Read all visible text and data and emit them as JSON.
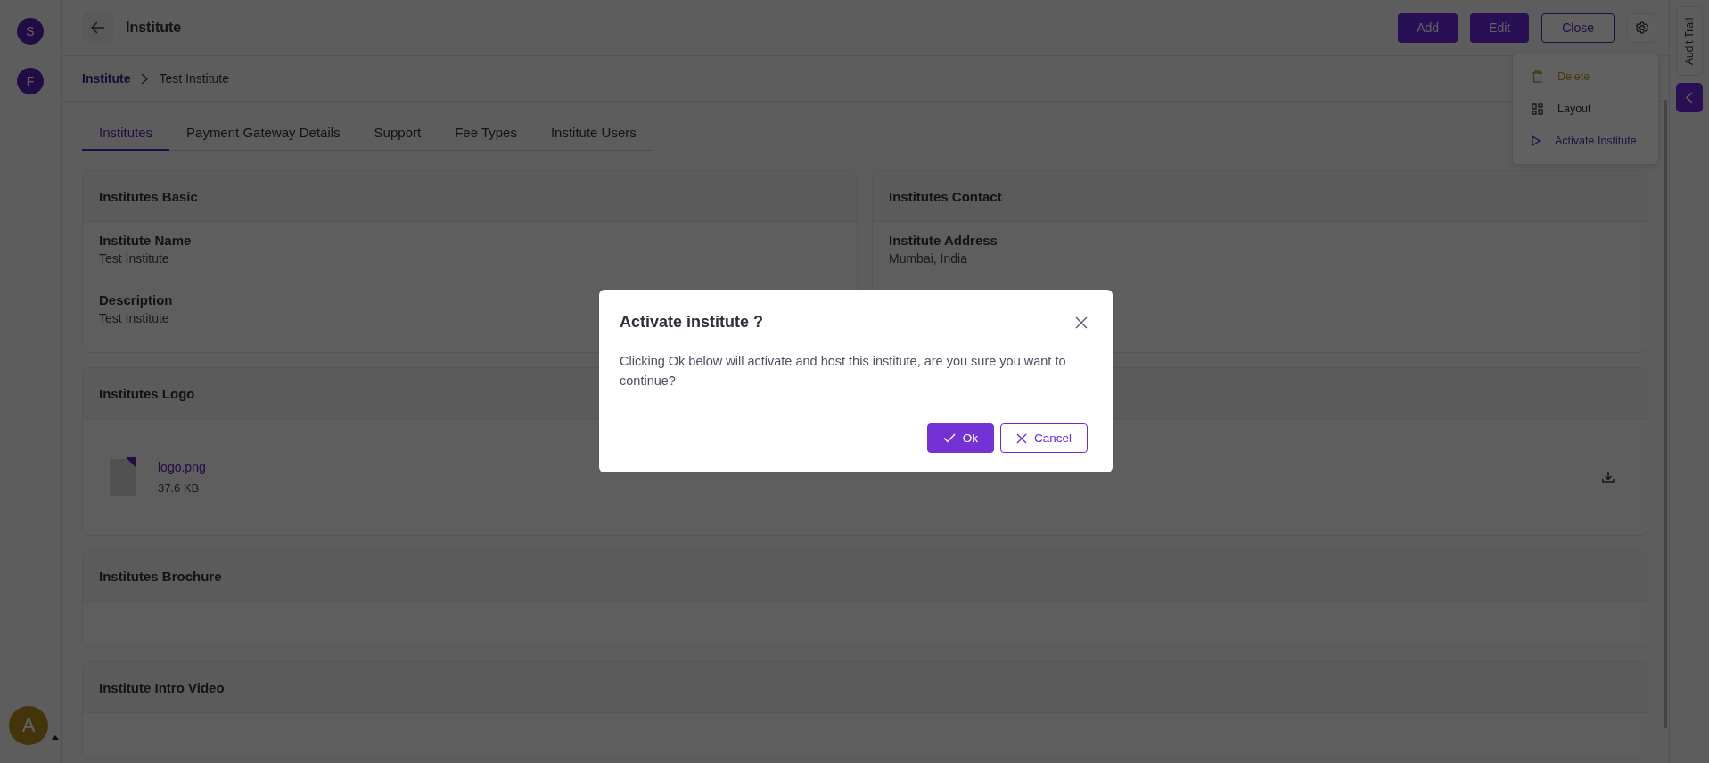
{
  "rail": {
    "avatars": [
      {
        "letter": "S"
      },
      {
        "letter": "F"
      }
    ],
    "user": {
      "letter": "A"
    }
  },
  "header": {
    "title": "Institute",
    "buttons": [
      {
        "label": "Add",
        "kind": "primary"
      },
      {
        "label": "Edit",
        "kind": "primary"
      },
      {
        "label": "Close",
        "kind": "outline"
      }
    ]
  },
  "settings_menu": {
    "items": [
      {
        "label": "Delete",
        "kind": "delete"
      },
      {
        "label": "Layout",
        "kind": "layout"
      },
      {
        "label": "Activate Institute",
        "kind": "activate"
      }
    ]
  },
  "audit_trail": {
    "label": "Audit Trail"
  },
  "breadcrumb": [
    "Institute",
    "Test Institute"
  ],
  "tabs": [
    {
      "label": "Institutes",
      "selected": true
    },
    {
      "label": "Payment Gateway Details",
      "selected": false
    },
    {
      "label": "Support",
      "selected": false
    },
    {
      "label": "Fee Types",
      "selected": false
    },
    {
      "label": "Institute Users",
      "selected": false
    }
  ],
  "sections": [
    {
      "kind": "fields",
      "title": "Institutes Basic",
      "fields": [
        {
          "label": "Institute Name",
          "value": "Test Institute"
        },
        {
          "label": "Description",
          "value": "Test Institute"
        }
      ]
    },
    {
      "kind": "fields",
      "title": "Institutes Contact",
      "fields": [
        {
          "label": "Institute Address",
          "value": "Mumbai, India"
        }
      ]
    },
    {
      "kind": "file",
      "title": "Institutes Logo",
      "file": {
        "name": "logo.png",
        "size": "37.6 KB"
      }
    },
    {
      "kind": "empty",
      "title": "Institutes Brochure"
    },
    {
      "kind": "empty",
      "title": "Institute Intro Video"
    }
  ],
  "dialog": {
    "title": "Activate institute ?",
    "message": "Clicking Ok below will activate and host this institute, are you sure you want to continue?",
    "buttons": [
      {
        "label": "Ok",
        "kind": "confirm"
      },
      {
        "label": "Cancel",
        "kind": "cancel"
      }
    ]
  }
}
